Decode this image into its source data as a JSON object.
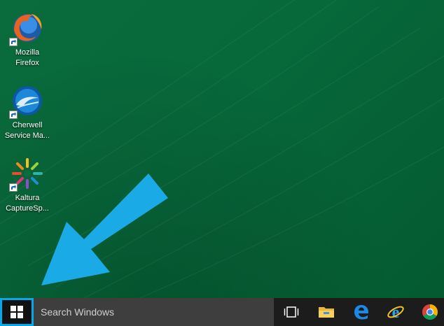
{
  "desktop": {
    "icons": [
      {
        "label_line1": "Mozilla",
        "label_line2": "Firefox",
        "icon": "firefox-icon"
      },
      {
        "label_line1": "Cherwell",
        "label_line2": "Service Ma...",
        "icon": "cherwell-icon"
      },
      {
        "label_line1": "Kaltura",
        "label_line2": "CaptureSp...",
        "icon": "kaltura-icon"
      }
    ],
    "wallpaper_color": "#07683a",
    "annotation_arrow_color": "#1aaae6"
  },
  "taskbar": {
    "search_placeholder": "Search Windows",
    "start_highlight_color": "#00a8f0",
    "pinned": [
      "task-view-icon",
      "file-explorer-icon",
      "edge-icon",
      "internet-explorer-icon",
      "chrome-icon"
    ]
  }
}
